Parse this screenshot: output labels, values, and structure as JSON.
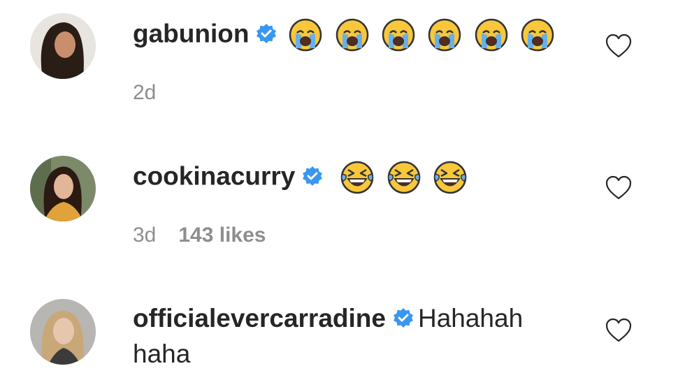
{
  "comments": [
    {
      "username": "gabunion",
      "verified": true,
      "emoji": "loudly-crying-face",
      "emoji_count": 6,
      "text": "",
      "time": "2d",
      "likes": ""
    },
    {
      "username": "cookinacurry",
      "verified": true,
      "emoji": "grinning-squinting-tears-face",
      "emoji_count": 3,
      "text": "",
      "time": "3d",
      "likes": "143 likes"
    },
    {
      "username": "officialevercarradine",
      "verified": true,
      "emoji": "",
      "emoji_count": 0,
      "text": "Hahahah haha",
      "time": "",
      "likes": ""
    }
  ],
  "icons": {
    "verified": "verified-badge-icon",
    "like": "heart-outline-icon"
  },
  "colors": {
    "verified_blue": "#3897f0",
    "meta_gray": "#8e8e8e",
    "text_dark": "#262626"
  }
}
